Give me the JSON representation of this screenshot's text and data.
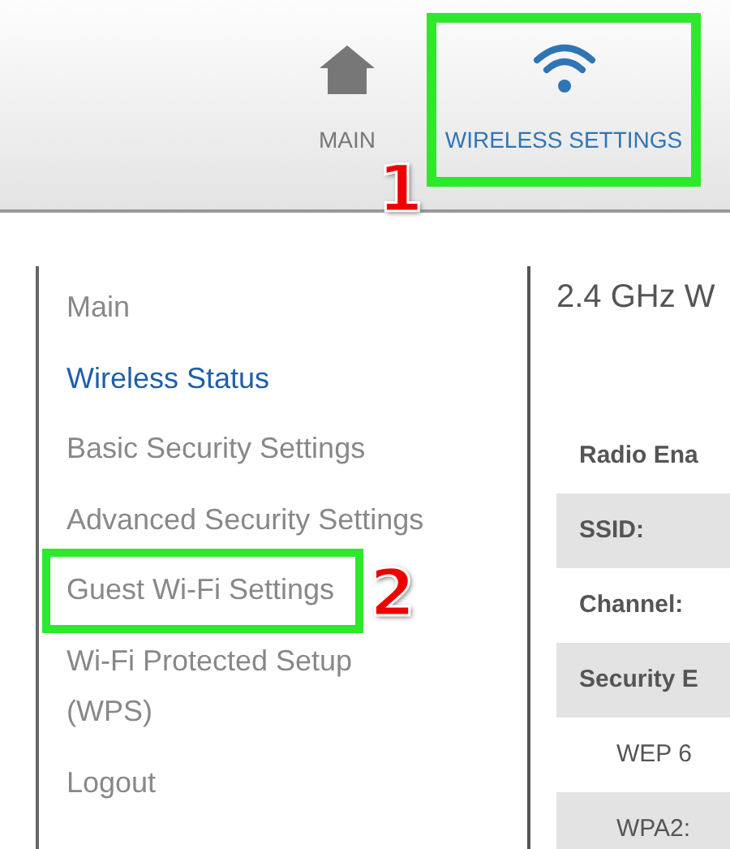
{
  "nav_tabs": [
    {
      "label": "MAIN",
      "kind": "home",
      "selected": false
    },
    {
      "label": "WIRELESS SETTINGS",
      "kind": "wireless",
      "selected": true,
      "step": "1"
    }
  ],
  "sidebar": {
    "items": [
      {
        "label": "Main",
        "selected": false
      },
      {
        "label": "Wireless Status",
        "selected": true
      },
      {
        "label": "Basic Security Settings",
        "selected": false
      },
      {
        "label": "Advanced Security Settings",
        "selected": false
      },
      {
        "label": "Guest Wi-Fi Settings",
        "selected": false,
        "step": "2"
      },
      {
        "label": "Wi-Fi Protected Setup (WPS)",
        "selected": false
      },
      {
        "label": "Logout",
        "selected": false
      }
    ]
  },
  "content": {
    "heading": "2.4 GHz W",
    "rows": [
      {
        "label": "Radio Ena",
        "kind": "field",
        "shaded": false
      },
      {
        "label": "SSID:",
        "kind": "field",
        "shaded": true
      },
      {
        "label": "Channel:",
        "kind": "field",
        "shaded": false
      },
      {
        "label": "Security E",
        "kind": "field",
        "shaded": true
      },
      {
        "label": "WEP 6",
        "kind": "option",
        "shaded": false
      },
      {
        "label": "WPA2:",
        "kind": "option",
        "shaded": true
      }
    ]
  }
}
